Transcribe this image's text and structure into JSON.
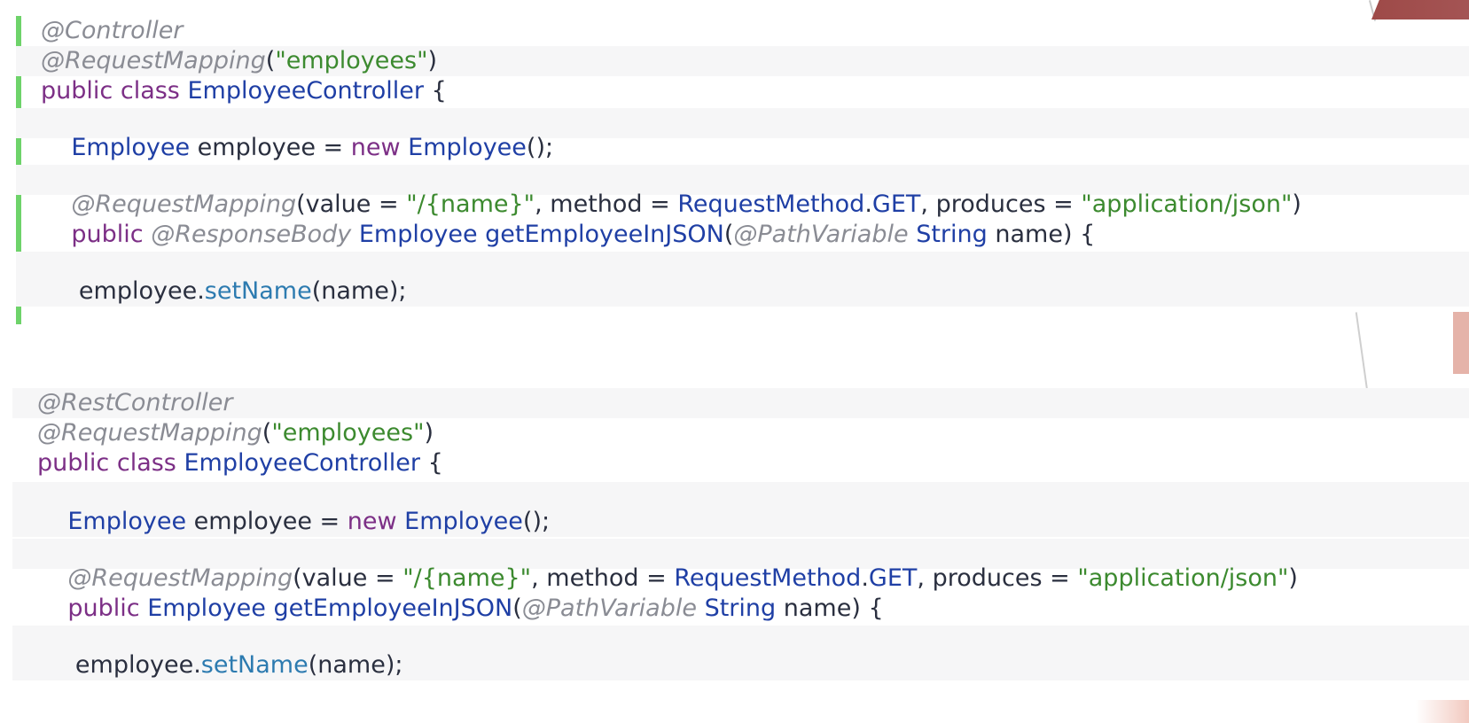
{
  "snippet_controller": {
    "lines": [
      {
        "text": "@Controller"
      },
      {
        "text": "@RequestMapping(\"employees\")"
      },
      {
        "text": "public class EmployeeController {"
      },
      {
        "text": ""
      },
      {
        "text": "    Employee employee = new Employee();"
      },
      {
        "text": ""
      },
      {
        "text": "    @RequestMapping(value = \"/{name}\", method = RequestMethod.GET, produces = \"application/json\")"
      },
      {
        "text": "    public @ResponseBody Employee getEmployeeInJSON(@PathVariable String name) {"
      },
      {
        "text": ""
      },
      {
        "text": "     employee.setName(name);"
      }
    ]
  },
  "snippet_rest_controller": {
    "lines": [
      {
        "text": "@RestController"
      },
      {
        "text": "@RequestMapping(\"employees\")"
      },
      {
        "text": "public class EmployeeController {"
      },
      {
        "text": ""
      },
      {
        "text": "    Employee employee = new Employee();"
      },
      {
        "text": ""
      },
      {
        "text": "    @RequestMapping(value = \"/{name}\", method = RequestMethod.GET, produces = \"application/json\")"
      },
      {
        "text": "    public Employee getEmployeeInJSON(@PathVariable String name) {"
      },
      {
        "text": ""
      },
      {
        "text": "     employee.setName(name);"
      }
    ]
  },
  "colors": {
    "annotation": "#8a8c94",
    "keyword": "#7c2f86",
    "type": "#1f3fa5",
    "string": "#3c8a2f",
    "method": "#2d7bb0",
    "gutter_marker": "#6ed36a",
    "line_shade": "#f6f6f7"
  }
}
